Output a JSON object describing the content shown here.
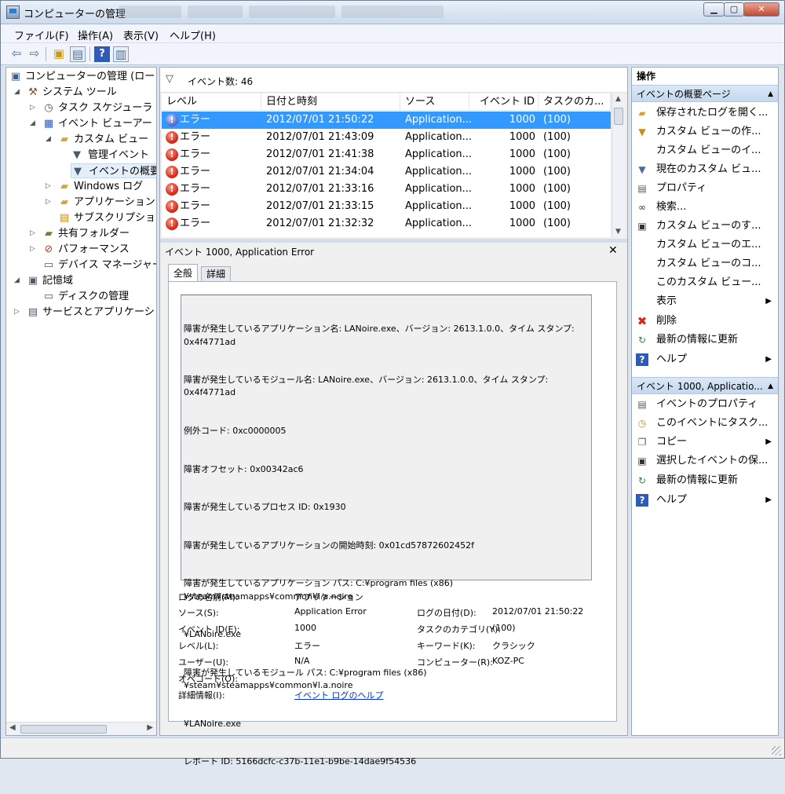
{
  "window": {
    "title": "コンピューターの管理"
  },
  "menu": [
    "ファイル(F)",
    "操作(A)",
    "表示(V)",
    "ヘルプ(H)"
  ],
  "tree": [
    {
      "label": "コンピューターの管理 (ローカ",
      "icon": "computer-icon"
    },
    {
      "label": "システム ツール",
      "icon": "tools-icon"
    },
    {
      "label": "タスク スケジューラ",
      "icon": "clock-icon"
    },
    {
      "label": "イベント ビューアー",
      "icon": "event-viewer-icon"
    },
    {
      "label": "カスタム ビュー",
      "icon": "folder-icon"
    },
    {
      "label": "管理イベント",
      "icon": "filter-icon"
    },
    {
      "label": "イベントの概要",
      "icon": "filter-icon"
    },
    {
      "label": "Windows ログ",
      "icon": "folder-icon"
    },
    {
      "label": "アプリケーションと",
      "icon": "folder-icon"
    },
    {
      "label": "サブスクリプション",
      "icon": "subscription-icon"
    },
    {
      "label": "共有フォルダー",
      "icon": "shared-folder-icon"
    },
    {
      "label": "パフォーマンス",
      "icon": "performance-icon"
    },
    {
      "label": "デバイス マネージャー",
      "icon": "device-manager-icon"
    },
    {
      "label": "記憶域",
      "icon": "storage-icon"
    },
    {
      "label": "ディスクの管理",
      "icon": "disk-icon"
    },
    {
      "label": "サービスとアプリケーショ",
      "icon": "services-icon"
    }
  ],
  "events": {
    "count_label": "イベント数: 46",
    "columns": [
      "レベル",
      "日付と時刻",
      "ソース",
      "イベント ID",
      "タスクのカ..."
    ],
    "rows": [
      {
        "level": "エラー",
        "datetime": "2012/07/01 21:50:22",
        "source": "Application...",
        "id": "1000",
        "task": "(100)",
        "selected": true
      },
      {
        "level": "エラー",
        "datetime": "2012/07/01 21:43:09",
        "source": "Application...",
        "id": "1000",
        "task": "(100)"
      },
      {
        "level": "エラー",
        "datetime": "2012/07/01 21:41:38",
        "source": "Application...",
        "id": "1000",
        "task": "(100)"
      },
      {
        "level": "エラー",
        "datetime": "2012/07/01 21:34:04",
        "source": "Application...",
        "id": "1000",
        "task": "(100)"
      },
      {
        "level": "エラー",
        "datetime": "2012/07/01 21:33:16",
        "source": "Application...",
        "id": "1000",
        "task": "(100)"
      },
      {
        "level": "エラー",
        "datetime": "2012/07/01 21:33:15",
        "source": "Application...",
        "id": "1000",
        "task": "(100)"
      },
      {
        "level": "エラー",
        "datetime": "2012/07/01 21:32:32",
        "source": "Application...",
        "id": "1000",
        "task": "(100)"
      }
    ]
  },
  "detail": {
    "title": "イベント 1000, Application Error",
    "tab_general": "全般",
    "tab_details": "詳細",
    "description_lines": [
      "障害が発生しているアプリケーション名: LANoire.exe、バージョン: 2613.1.0.0、タイム スタンプ: 0x4f4771ad",
      "障害が発生しているモジュール名: LANoire.exe、バージョン: 2613.1.0.0、タイム スタンプ: 0x4f4771ad",
      "例外コード: 0xc0000005",
      "障害オフセット: 0x00342ac6",
      "障害が発生しているプロセス ID: 0x1930",
      "障害が発生しているアプリケーションの開始時刻: 0x01cd57872602452f",
      "障害が発生しているアプリケーション パス: C:¥program files (x86)¥steam¥steamapps¥common¥l.a.noire",
      "¥LANoire.exe",
      "障害が発生しているモジュール パス: C:¥program files (x86)¥steam¥steamapps¥common¥l.a.noire",
      "¥LANoire.exe",
      "レポート ID: 5166dcfc-c37b-11e1-b9be-14dae9f54536"
    ],
    "fields": {
      "log_name_label": "ログの名前(M):",
      "log_name": "アプリケーション",
      "source_label": "ソース(S):",
      "source": "Application Error",
      "logged_label": "ログの日付(D):",
      "logged": "2012/07/01 21:50:22",
      "event_id_label": "イベント ID(E):",
      "event_id": "1000",
      "task_label": "タスクのカテゴリ(Y):",
      "task": "(100)",
      "level_label": "レベル(L):",
      "level": "エラー",
      "keywords_label": "キーワード(K):",
      "keywords": "クラシック",
      "user_label": "ユーザー(U):",
      "user": "N/A",
      "computer_label": "コンピューター(R):",
      "computer": "KOZ-PC",
      "opcode_label": "オペコード(O):",
      "more_info_label": "詳細情報(I):",
      "more_info_link": "イベント ログのヘルプ"
    }
  },
  "actions": {
    "header": "操作",
    "section1": "イベントの概要ページ",
    "items1": [
      {
        "label": "保存されたログを開く...",
        "icon": "open-folder-icon"
      },
      {
        "label": "カスタム ビューの作...",
        "icon": "filter-icon"
      },
      {
        "label": "カスタム ビューのイ...",
        "icon": ""
      },
      {
        "label": "現在のカスタム ビュ...",
        "icon": "filter-icon"
      },
      {
        "label": "プロパティ",
        "icon": "properties-icon"
      },
      {
        "label": "検索...",
        "icon": "binoculars-icon"
      },
      {
        "label": "カスタム ビューのす...",
        "icon": "save-icon"
      },
      {
        "label": "カスタム ビューのエ...",
        "icon": ""
      },
      {
        "label": "カスタム ビューのコ...",
        "icon": ""
      },
      {
        "label": "このカスタム ビュー...",
        "icon": ""
      },
      {
        "label": "表示",
        "icon": "",
        "submenu": true
      },
      {
        "label": "削除",
        "icon": "delete-icon"
      },
      {
        "label": "最新の情報に更新",
        "icon": "refresh-icon"
      },
      {
        "label": "ヘルプ",
        "icon": "help-icon",
        "submenu": true
      }
    ],
    "section2": "イベント 1000, Applicatio...",
    "items2": [
      {
        "label": "イベントのプロパティ",
        "icon": "properties-icon"
      },
      {
        "label": "このイベントにタスク...",
        "icon": "task-icon"
      },
      {
        "label": "コピー",
        "icon": "copy-icon",
        "submenu": true
      },
      {
        "label": "選択したイベントの保...",
        "icon": "save-icon"
      },
      {
        "label": "最新の情報に更新",
        "icon": "refresh-icon"
      },
      {
        "label": "ヘルプ",
        "icon": "help-icon",
        "submenu": true
      }
    ]
  }
}
